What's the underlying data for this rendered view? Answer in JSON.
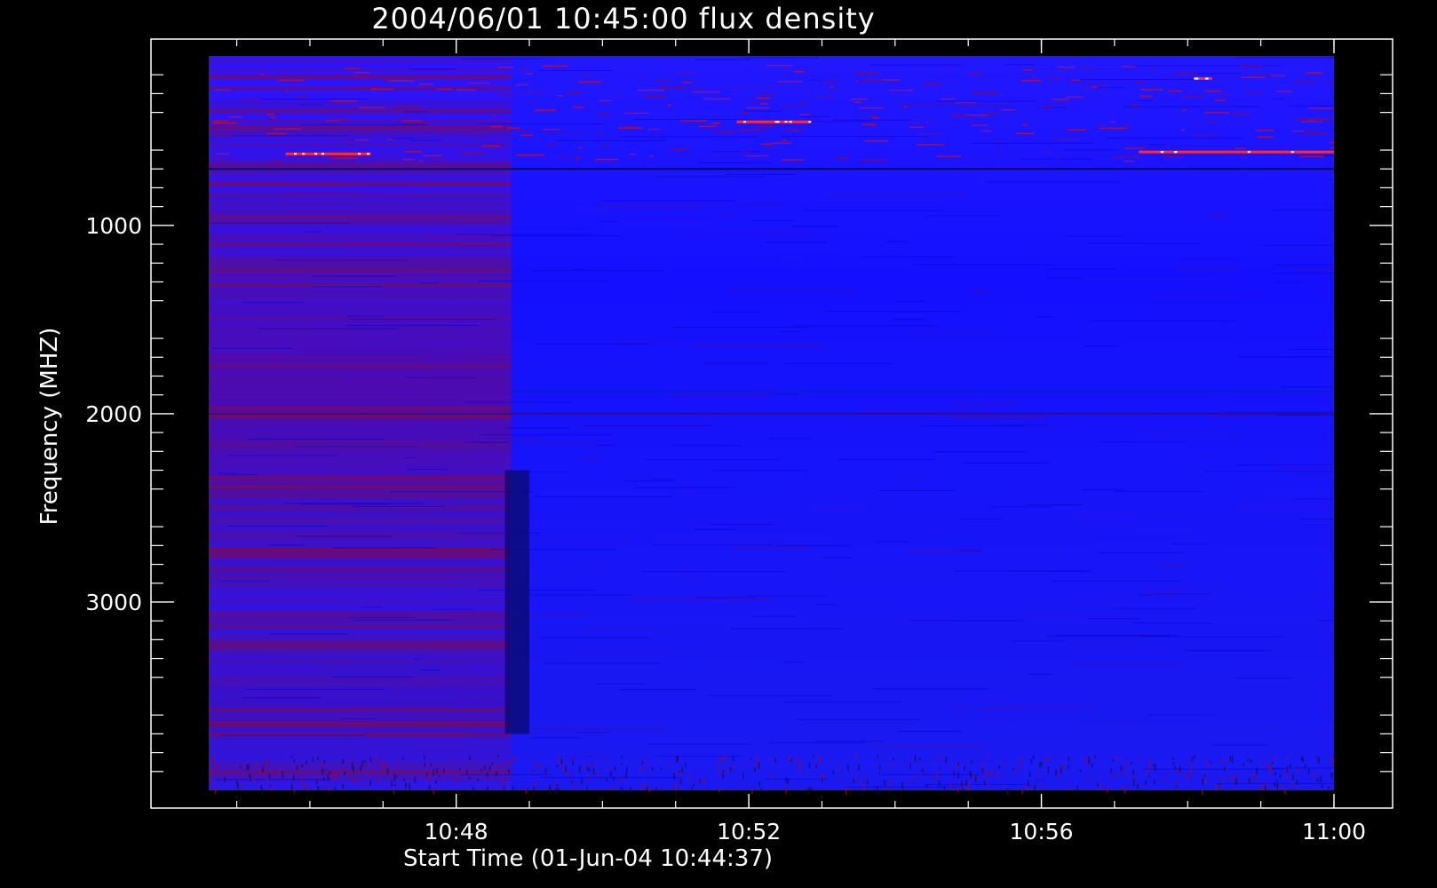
{
  "chart_data": {
    "type": "heatmap",
    "title": "2004/06/01 10:45:00 flux density",
    "xlabel": "Start Time (01-Jun-04 10:44:37)",
    "ylabel": "Frequency (MHZ)",
    "x_range": [
      "10:44:37",
      "11:00:00"
    ],
    "y_range_mhz": [
      100,
      4000
    ],
    "y_axis_inverted": true,
    "x_ticks": [
      {
        "label": "10:48",
        "time": "10:48:00"
      },
      {
        "label": "10:52",
        "time": "10:52:00"
      },
      {
        "label": "10:56",
        "time": "10:56:00"
      },
      {
        "label": "11:00",
        "time": "11:00:00"
      }
    ],
    "y_ticks": [
      {
        "label": "1000",
        "value": 1000
      },
      {
        "label": "2000",
        "value": 2000
      },
      {
        "label": "3000",
        "value": 3000
      }
    ],
    "colors": {
      "background": "#000000",
      "axis": "#ffffff",
      "low_flux": "#0000ff",
      "mid_flux": "#6a0080",
      "high_flux": "#ff2a2a",
      "peak_flux": "#ffffff"
    },
    "features": {
      "early_segment_end": "10:48:45",
      "data_gap_band": {
        "start": "10:48:40",
        "end": "10:49:00",
        "freq_mhz": [
          2300,
          3700
        ]
      },
      "horizontal_lines_mhz": [
        700,
        2000,
        2900
      ],
      "bright_bursts": [
        {
          "time_start": "10:51:50",
          "time_end": "10:52:50",
          "freq_mhz": 450
        },
        {
          "time_start": "10:57:20",
          "time_end": "11:00:00",
          "freq_mhz": 610
        },
        {
          "time_start": "10:58:05",
          "time_end": "10:58:20",
          "freq_mhz": 220
        },
        {
          "time_start": "10:45:40",
          "time_end": "10:46:50",
          "freq_mhz": 620
        }
      ]
    }
  }
}
